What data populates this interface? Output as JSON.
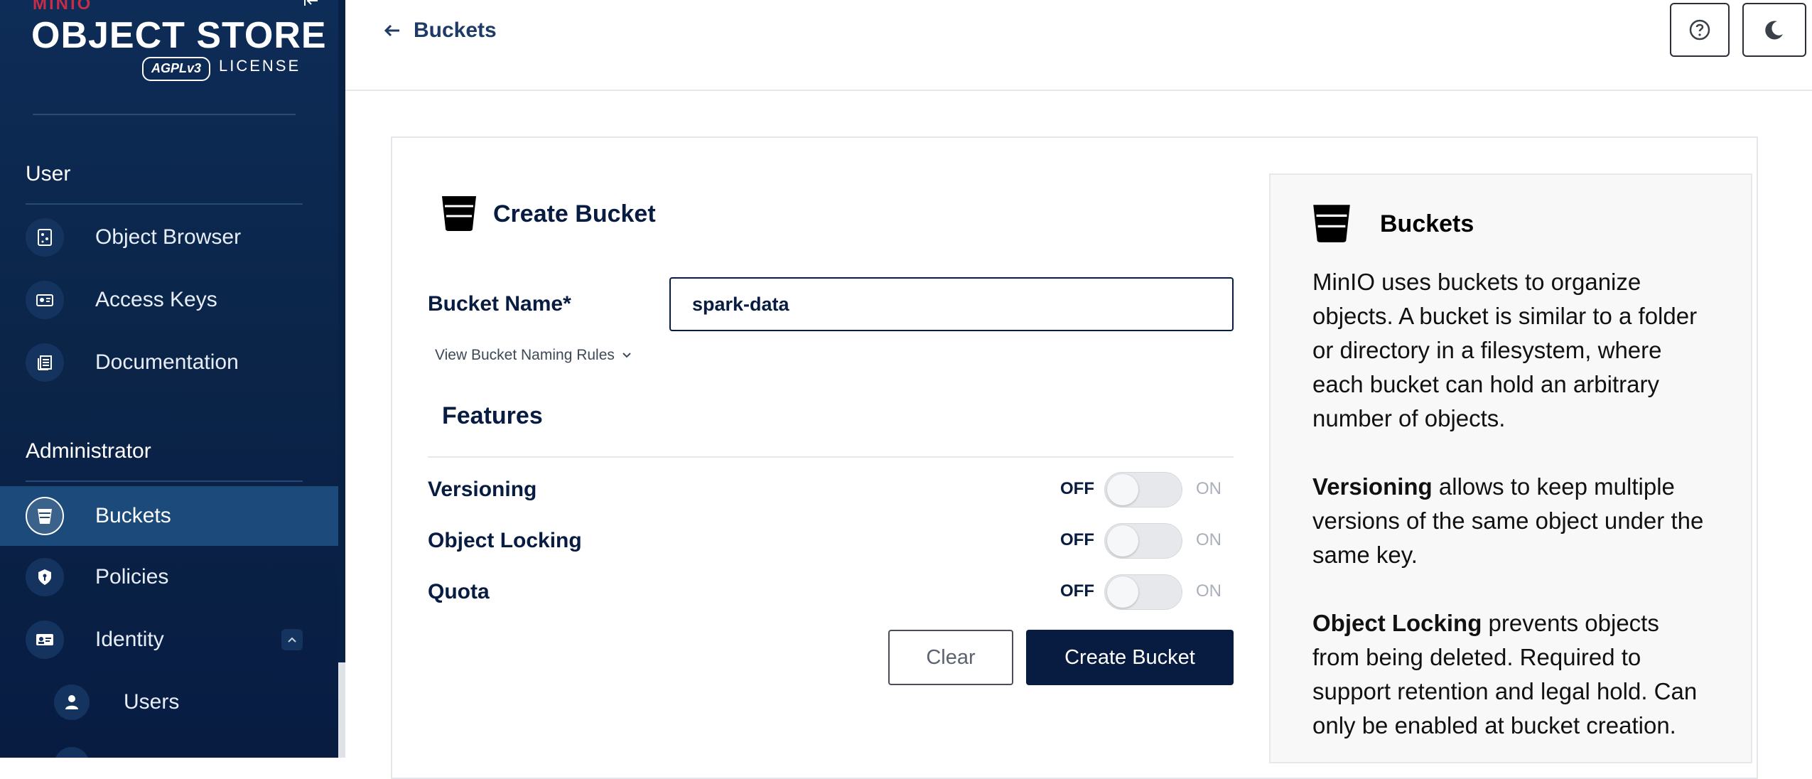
{
  "sidebar": {
    "logo_small": "MINIO",
    "logo_main": "OBJECT STORE",
    "logo_badge": "AGPLv3",
    "logo_license": "LICENSE",
    "user_section": "User",
    "user_items": [
      {
        "label": "Object Browser",
        "icon": "object-browser-icon"
      },
      {
        "label": "Access Keys",
        "icon": "access-keys-icon"
      },
      {
        "label": "Documentation",
        "icon": "documentation-icon"
      }
    ],
    "admin_section": "Administrator",
    "admin_items": [
      {
        "label": "Buckets",
        "icon": "bucket-icon",
        "active": true
      },
      {
        "label": "Policies",
        "icon": "policy-shield-icon"
      },
      {
        "label": "Identity",
        "icon": "identity-card-icon",
        "expanded": true
      },
      {
        "label": "Users",
        "icon": "user-icon"
      }
    ]
  },
  "header": {
    "back_label": "Buckets",
    "help_button": "help-icon",
    "theme_button": "moon-icon"
  },
  "form": {
    "title": "Create Bucket",
    "bucket_name_label": "Bucket Name*",
    "bucket_name_value": "spark-data",
    "naming_rules_link": "View Bucket Naming Rules",
    "features_title": "Features",
    "features": [
      {
        "label": "Versioning",
        "off": "OFF",
        "on": "ON",
        "state": "off"
      },
      {
        "label": "Object Locking",
        "off": "OFF",
        "on": "ON",
        "state": "off"
      },
      {
        "label": "Quota",
        "off": "OFF",
        "on": "ON",
        "state": "off"
      }
    ],
    "clear_label": "Clear",
    "create_label": "Create Bucket"
  },
  "help": {
    "title": "Buckets",
    "intro": "MinIO uses buckets to organize objects. A bucket is similar to a folder or directory in a filesystem, where each bucket can hold an arbitrary number of objects.",
    "versioning_term": "Versioning",
    "versioning_text": " allows to keep multiple versions of the same object under the same key.",
    "locking_term": "Object Locking",
    "locking_text": " prevents objects from being deleted. Required to support retention and legal hold. Can only be enabled at bucket creation."
  },
  "colors": {
    "sidebar_bg": "#0b2549",
    "active_item": "#1c4a7a",
    "primary": "#081c42",
    "brand_red": "#c72c48"
  }
}
